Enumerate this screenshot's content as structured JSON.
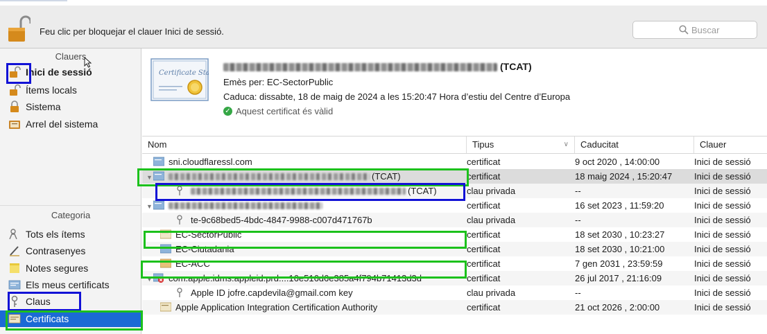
{
  "toolbar": {
    "lock_text": "Feu clic per bloquejar el clauer Inici de sessió.",
    "search_placeholder": "Buscar"
  },
  "sidebar": {
    "keychains_header": "Clauers",
    "keychains": [
      {
        "label": "Inici de sessió",
        "icon": "padlock-open-icon"
      },
      {
        "label": "Ítems locals",
        "icon": "padlock-open-icon"
      },
      {
        "label": "Sistema",
        "icon": "padlock-closed-icon"
      },
      {
        "label": "Arrel del sistema",
        "icon": "certificate-folder-icon"
      }
    ],
    "category_header": "Categoria",
    "categories": [
      {
        "label": "Tots els ítems",
        "icon": "people-icon"
      },
      {
        "label": "Contrasenyes",
        "icon": "pen-icon"
      },
      {
        "label": "Notes segures",
        "icon": "note-icon"
      },
      {
        "label": "Els meus certificats",
        "icon": "my-certificate-icon"
      },
      {
        "label": "Claus",
        "icon": "key-icon"
      },
      {
        "label": "Certificats",
        "icon": "certificate-icon"
      }
    ]
  },
  "detail": {
    "title_suffix": "(TCAT)",
    "issuer": "Emès per: EC-SectorPublic",
    "expiry": "Caduca: dissabte, 18 de maig de 2024 a les 15:20:47 Hora d’estiu del Centre d’Europa",
    "status": "Aquest certificat és vàlid",
    "image_caption": "Certificate Standard"
  },
  "table": {
    "headers": {
      "name": "Nom",
      "type": "Tipus",
      "expires": "Caducitat",
      "keychain": "Clauer"
    },
    "rows": [
      {
        "name": "sni.cloudflaressl.com",
        "type": "certificat",
        "expires": "9 oct 2020 , 14:00:00",
        "keychain": "Inici de sessió"
      },
      {
        "name": "(TCAT)",
        "type": "certificat",
        "expires": "18 maig 2024 , 15:20:47",
        "keychain": "Inici de sessió"
      },
      {
        "name": "(TCAT)",
        "type": "clau privada",
        "expires": "--",
        "keychain": "Inici de sessió"
      },
      {
        "name": "",
        "type": "certificat",
        "expires": "16 set 2023 , 11:59:20",
        "keychain": "Inici de sessió"
      },
      {
        "name": "te-9c68bed5-4bdc-4847-9988-c007d471767b",
        "type": "clau privada",
        "expires": "--",
        "keychain": "Inici de sessió"
      },
      {
        "name": "EC-SectorPublic",
        "type": "certificat",
        "expires": "18 set 2030 , 10:23:27",
        "keychain": "Inici de sessió"
      },
      {
        "name": "EC-Ciutadania",
        "type": "certificat",
        "expires": "18 set 2030 , 10:21:00",
        "keychain": "Inici de sessió"
      },
      {
        "name": "EC-ACC",
        "type": "certificat",
        "expires": "7 gen 2031 , 23:59:59",
        "keychain": "Inici de sessió"
      },
      {
        "name": "com.apple.idms.appleid.prd....16e516d6e385a4f794b71413d3d",
        "type": "certificat",
        "expires": "26 jul 2017 , 21:16:09",
        "keychain": "Inici de sessió"
      },
      {
        "name": "Apple ID jofre.capdevila@gmail.com key",
        "type": "clau privada",
        "expires": "--",
        "keychain": "Inici de sessió"
      },
      {
        "name": "Apple Application Integration Certification Authority",
        "type": "certificat",
        "expires": "21 oct 2026 , 2:00:00",
        "keychain": "Inici de sessió"
      }
    ]
  },
  "colors": {
    "highlight_green": "#1cc11c",
    "highlight_blue": "#1212d6",
    "selection_blue": "#1b6ad5"
  }
}
